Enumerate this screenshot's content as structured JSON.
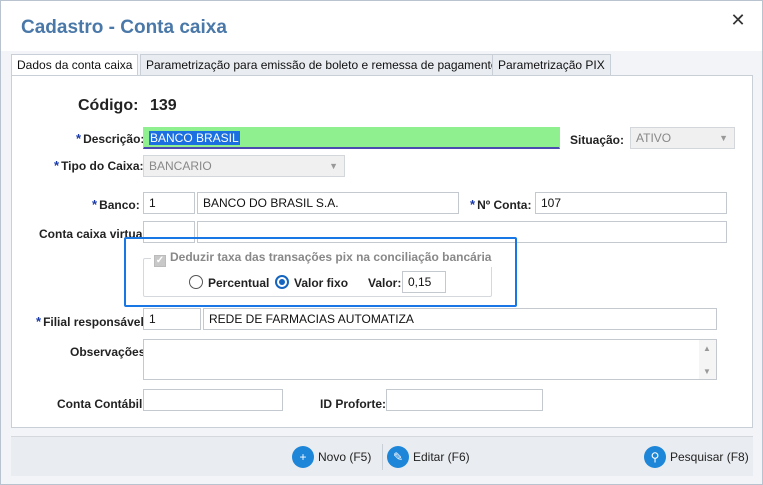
{
  "window": {
    "title": "Cadastro - Conta caixa",
    "close_label": "✕"
  },
  "tabs": [
    {
      "label": "Dados da conta caixa"
    },
    {
      "label": "Parametrização para emissão de boleto e remessa de pagamento"
    },
    {
      "label": "Parametrização PIX"
    }
  ],
  "form": {
    "codigo_label": "Código:",
    "codigo_value": "139",
    "required_mark": "*",
    "descricao_label": "Descrição:",
    "descricao_value": "BANCO BRASIL",
    "situacao_label": "Situação:",
    "situacao_value": "ATIVO",
    "tipo_caixa_label": "Tipo do Caixa:",
    "tipo_caixa_value": "BANCARIO",
    "banco_label": "Banco:",
    "banco_code": "1",
    "banco_name": "BANCO DO BRASIL S.A.",
    "conta_label": "Nº Conta:",
    "conta_value": "107",
    "conta_virtual_label": "Conta caixa virtual:",
    "pix_group_title": "Deduzir taxa das transações pix na conciliação bancária",
    "percentual_label": "Percentual",
    "valor_fixo_label": "Valor fixo",
    "valor_label": "Valor:",
    "valor_value": "0,15",
    "filial_label": "Filial responsável:",
    "filial_code": "1",
    "filial_name": "REDE DE FARMACIAS AUTOMATIZA",
    "observacoes_label": "Observações:",
    "conta_contabil_label": "Conta Contábil:",
    "id_proforte_label": "ID Proforte:"
  },
  "footer": {
    "novo_label": "Novo (F5)",
    "editar_label": "Editar (F6)",
    "pesquisar_label": "Pesquisar (F8)"
  },
  "icons": {
    "novo": "plus-icon",
    "editar": "pencil-icon",
    "pesquisar": "search-icon",
    "dropdown": "chevron-down-icon"
  },
  "colors": {
    "title": "#4a78a8",
    "required": "#1a3aa8",
    "highlight": "#1877e5",
    "description_bg": "#8ff08f",
    "button_icon": "#1e86d8"
  }
}
